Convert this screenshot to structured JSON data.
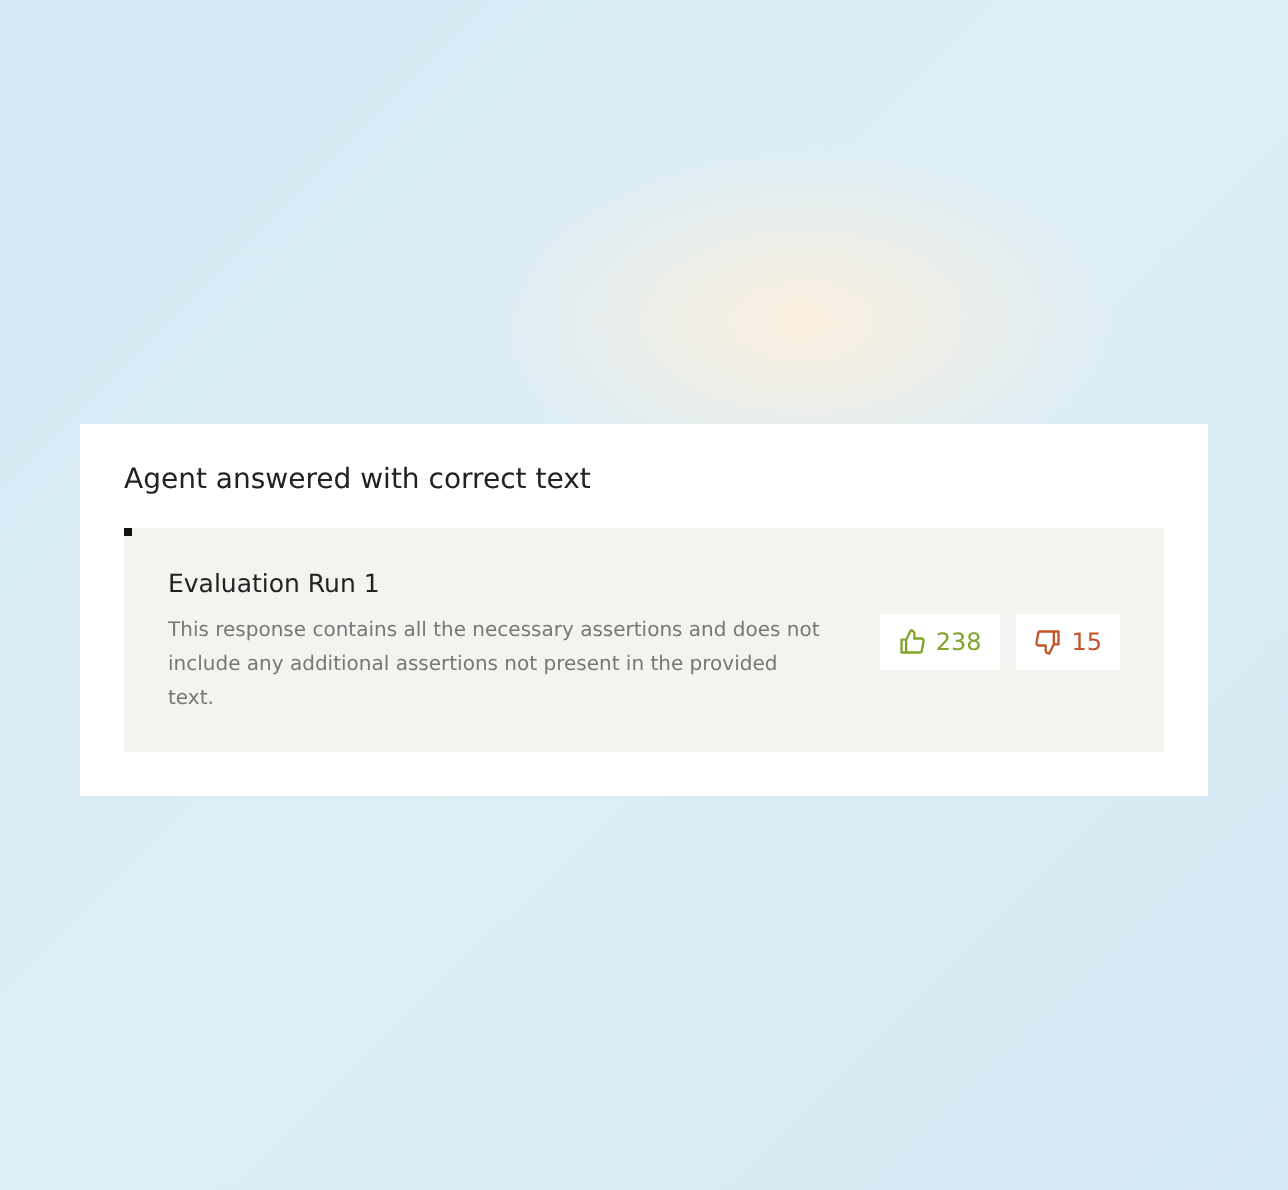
{
  "card": {
    "title": "Agent answered with correct text",
    "run": {
      "title": "Evaluation Run 1",
      "description": "This response contains all the necessary assertions and does not include any additional assertions not present in the provided text.",
      "votes": [
        {
          "kind": "up",
          "count": "238"
        },
        {
          "kind": "down",
          "count": "15"
        }
      ]
    }
  }
}
